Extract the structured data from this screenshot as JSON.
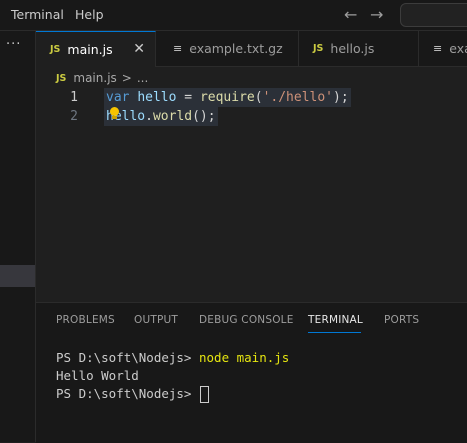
{
  "menu": {
    "terminal": "Terminal",
    "help": "Help"
  },
  "nav": {
    "back_icon": "arrow-left-icon",
    "forward_icon": "arrow-right-icon"
  },
  "sidebar": {
    "more": "···"
  },
  "tabs": [
    {
      "label": "main.js",
      "type": "js",
      "active": true
    },
    {
      "label": "example.txt.gz",
      "type": "txt",
      "active": false
    },
    {
      "label": "hello.js",
      "type": "js",
      "active": false
    },
    {
      "label": "exa",
      "type": "txt",
      "active": false
    }
  ],
  "file_icons": {
    "js": "JS",
    "txt": "≡"
  },
  "tab_close": "✕",
  "breadcrumb": {
    "file_badge": "JS",
    "file": "main.js",
    "separator": ">",
    "rest": "..."
  },
  "editor": {
    "lines": [
      {
        "number": "1",
        "tokens": [
          "var",
          " ",
          "hello",
          " = ",
          "require",
          "(",
          "'./hello'",
          ");"
        ]
      },
      {
        "number": "2",
        "tokens": [
          "hello",
          ".",
          "world",
          "();"
        ]
      }
    ],
    "current_line": 1
  },
  "panel": {
    "tabs": [
      "PROBLEMS",
      "OUTPUT",
      "DEBUG CONSOLE",
      "TERMINAL",
      "PORTS"
    ],
    "active_tab": "TERMINAL",
    "terminal": {
      "prompt1": "PS D:\\soft\\Nodejs> ",
      "command": "node main.js",
      "output": "Hello World",
      "prompt2": "PS D:\\soft\\Nodejs> "
    }
  },
  "colors": {
    "accent": "#0078d4",
    "js_badge": "#cbcb41",
    "terminal_command": "#e5e510"
  }
}
